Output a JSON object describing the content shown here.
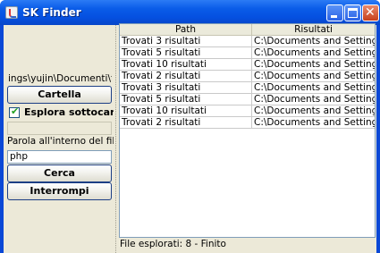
{
  "window": {
    "title": "SK Finder",
    "colors": {
      "titlebar": "#0a5ce8",
      "close": "#c7401b",
      "panel": "#ece9d8"
    }
  },
  "left_panel": {
    "folder_path": "ings\\yujin\\Documenti\\test",
    "folder_button_label": "Cartella",
    "subfolders_label": "Esplora sottocartelle",
    "subfolders_checked": true,
    "word_label": "Parola all'interno del file",
    "search_value": "php",
    "search_button_label": "Cerca",
    "stop_button_label": "Interrompi"
  },
  "table": {
    "columns": [
      "Path",
      "Risultati"
    ],
    "rows": [
      [
        "Trovati 3 risultati",
        "C:\\Documents and Settings\\..."
      ],
      [
        "Trovati 5 risultati",
        "C:\\Documents and Settings\\..."
      ],
      [
        "Trovati 10 risultati",
        "C:\\Documents and Settings\\..."
      ],
      [
        "Trovati 2 risultati",
        "C:\\Documents and Settings\\..."
      ],
      [
        "Trovati 3 risultati",
        "C:\\Documents and Settings\\..."
      ],
      [
        "Trovati 5 risultati",
        "C:\\Documents and Settings\\..."
      ],
      [
        "Trovati 10 risultati",
        "C:\\Documents and Settings\\..."
      ],
      [
        "Trovati 2 risultati",
        "C:\\Documents and Settings\\..."
      ]
    ]
  },
  "status_text": "File esplorati: 8 - Finito",
  "icons": [
    "java-app-icon",
    "minimize-icon",
    "maximize-icon",
    "close-icon",
    "checkmark-icon"
  ]
}
